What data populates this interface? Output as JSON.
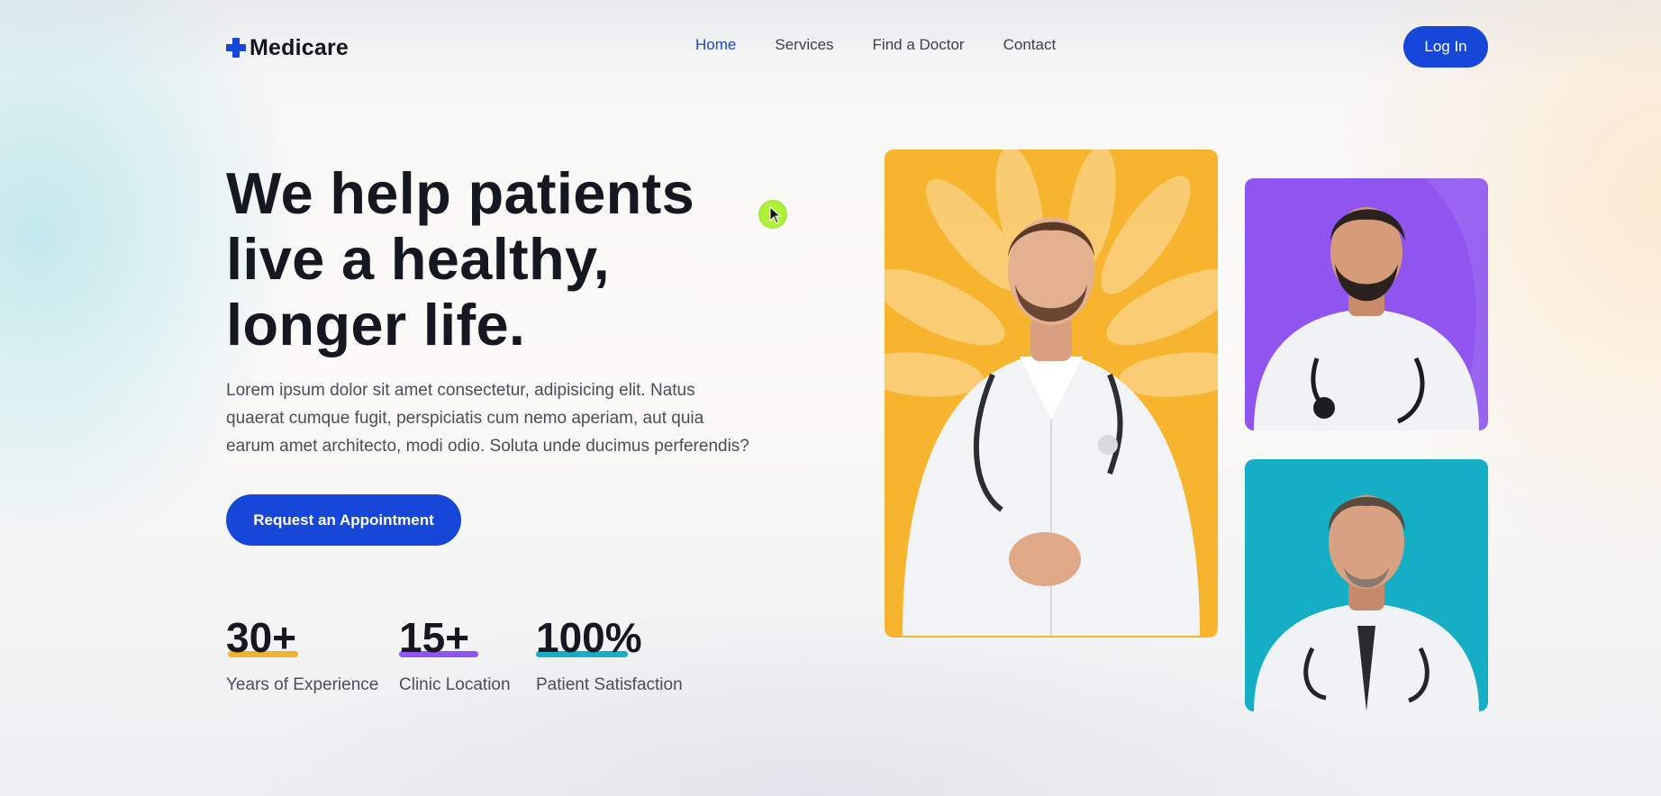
{
  "brand": {
    "name": "Medicare",
    "icon": "plus-cross-icon",
    "accent_color": "#1647d8"
  },
  "nav": {
    "items": [
      {
        "label": "Home",
        "active": true
      },
      {
        "label": "Services",
        "active": false
      },
      {
        "label": "Find a Doctor",
        "active": false
      },
      {
        "label": "Contact",
        "active": false
      }
    ],
    "login_label": "Log In"
  },
  "hero": {
    "headline_lines": [
      "We help patients",
      "live a healthy,",
      "longer life."
    ],
    "description_lines": [
      "Lorem ipsum dolor sit amet consectetur, adipisicing elit. Natus",
      "quaerat cumque fugit, perspiciatis cum nemo aperiam, aut quia",
      "earum amet architecto, modi odio. Soluta unde ducimus perferendis?"
    ],
    "cta_label": "Request an Appointment"
  },
  "stats": [
    {
      "value": "30+",
      "label": "Years of Experience",
      "bar_color": "#f0b32b"
    },
    {
      "value": "15+",
      "label": "Clinic Location",
      "bar_color": "#8f55ee"
    },
    {
      "value": "100%",
      "label": "Patient Satisfaction",
      "bar_color": "#16aec4"
    }
  ],
  "photos": [
    {
      "name": "doctor-main",
      "background": "#f7b42e"
    },
    {
      "name": "doctor-top",
      "background": "#8f55ee"
    },
    {
      "name": "doctor-bottom",
      "background": "#16aec4"
    }
  ]
}
